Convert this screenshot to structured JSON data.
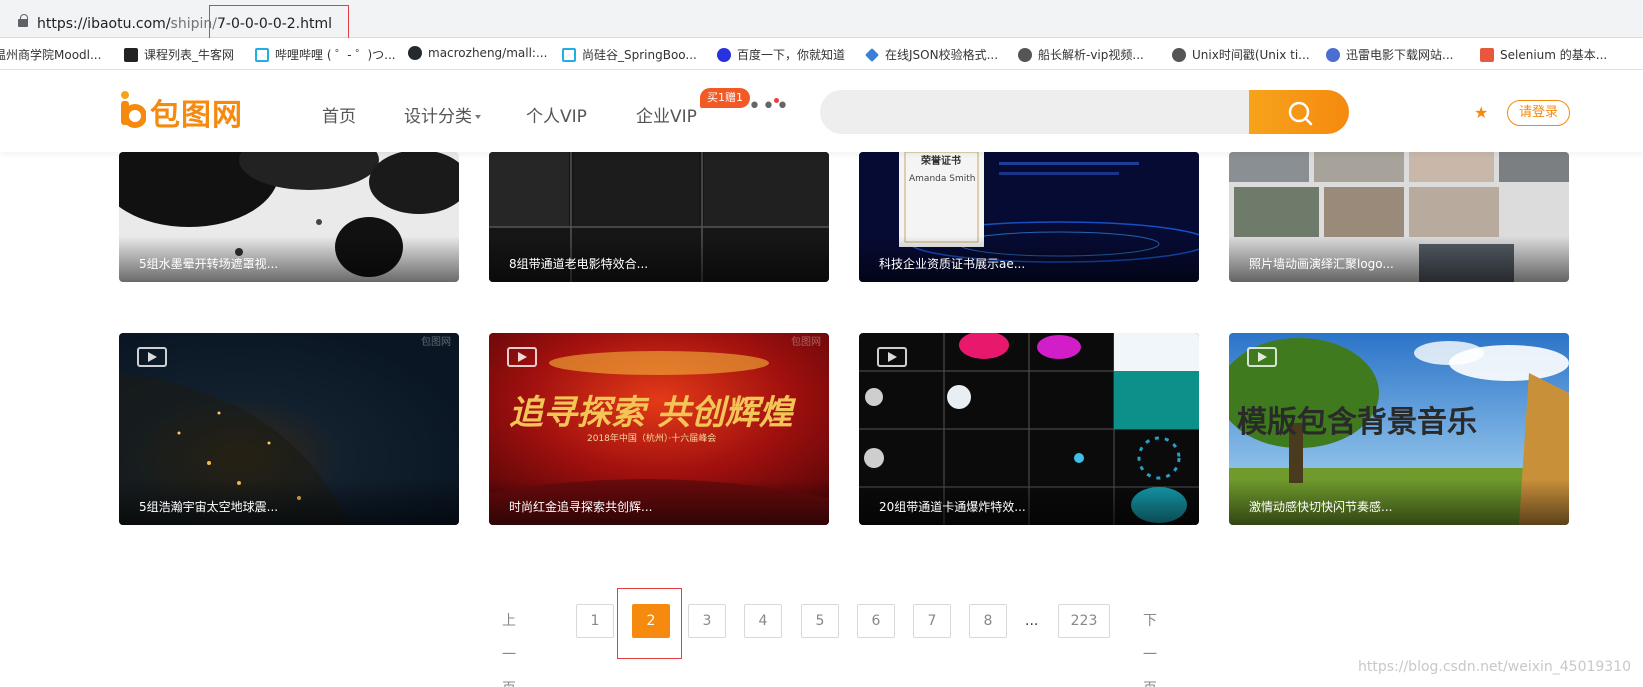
{
  "browser": {
    "url_base": "https://ibaotu.com/",
    "url_path": "shipin/",
    "url_highlight": "7-0-0-0-0-2.html"
  },
  "bookmarks": [
    {
      "label": "温州商学院Moodl...",
      "icon": "moodle-icon",
      "color": "#f3a43c"
    },
    {
      "label": "课程列表_牛客网",
      "icon": "nowcoder-icon",
      "color": "#222222"
    },
    {
      "label": "哔哩哔哩 ( ゜- ゜)つ...",
      "icon": "bilibili-icon",
      "color": "#23ade5"
    },
    {
      "label": "macrozheng/mall:...",
      "icon": "github-icon",
      "color": "#24292e"
    },
    {
      "label": "尚硅谷_SpringBoo...",
      "icon": "bilibili-icon",
      "color": "#23ade5"
    },
    {
      "label": "百度一下，你就知道",
      "icon": "baidu-icon",
      "color": "#2932e1"
    },
    {
      "label": "在线JSON校验格式...",
      "icon": "json-icon",
      "color": "#3b7fd6"
    },
    {
      "label": "船长解析-vip视频...",
      "icon": "globe-icon",
      "color": "#555555"
    },
    {
      "label": "Unix时间戳(Unix ti...",
      "icon": "globe-icon",
      "color": "#555555"
    },
    {
      "label": "迅雷电影下载网站...",
      "icon": "xunlei-icon",
      "color": "#4a6fd1"
    },
    {
      "label": "Selenium 的基本...",
      "icon": "jian-icon",
      "color": "#e8583d"
    }
  ],
  "header": {
    "logo": "包图网",
    "nav": [
      "首页",
      "设计分类",
      "个人VIP",
      "企业VIP"
    ],
    "vip_badge": "买1赠1",
    "more": "•••",
    "search_placeholder": "",
    "login": "请登录",
    "accent": "#f58a0f"
  },
  "cards_row1": [
    {
      "caption": "5组水墨晕开转场遮罩视...",
      "theme": "ink"
    },
    {
      "caption": "8组带通道老电影特效合...",
      "theme": "film"
    },
    {
      "caption": "科技企业资质证书展示ae...",
      "theme": "cert",
      "cert_title": "荣誉证书",
      "cert_name": "Amanda Smith"
    },
    {
      "caption": "照片墙动画演绎汇聚logo...",
      "theme": "photos"
    }
  ],
  "cards_row2": [
    {
      "caption": "5组浩瀚宇宙太空地球震...",
      "theme": "earth",
      "watermark": "包图网"
    },
    {
      "caption": "时尚红金追寻探索共创辉...",
      "theme": "red",
      "watermark": "包图网",
      "headline": "追寻探索 共创辉煌",
      "subline": "2018年中国（杭州）·十六届峰会"
    },
    {
      "caption": "20组带通道卡通爆炸特效...",
      "theme": "cartoon"
    },
    {
      "caption": "激情动感快切快闪节奏感...",
      "theme": "tree",
      "headline": "模版包含背景音乐"
    }
  ],
  "pagination": {
    "prev": "上一页",
    "pages": [
      "1",
      "2",
      "3",
      "4",
      "5",
      "6",
      "7",
      "8"
    ],
    "current": "2",
    "ellipsis": "...",
    "last": "223",
    "next": "下一页"
  },
  "footer_watermark": "https://blog.csdn.net/weixin_45019310"
}
